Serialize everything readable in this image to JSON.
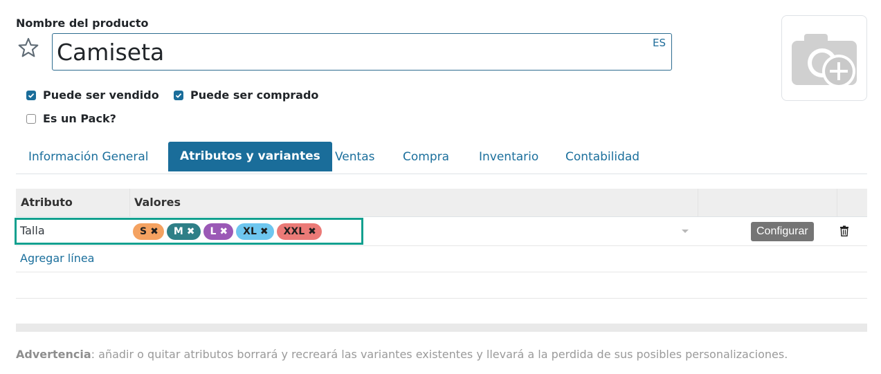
{
  "product": {
    "label": "Nombre del producto",
    "name": "Camiseta",
    "lang": "ES"
  },
  "checkboxes": [
    {
      "label": "Puede ser vendido",
      "checked": true
    },
    {
      "label": "Puede ser comprado",
      "checked": true
    },
    {
      "label": "Es un Pack?",
      "checked": false
    }
  ],
  "tabs": [
    {
      "label": "Información General",
      "active": false
    },
    {
      "label": "Atributos y variantes",
      "active": true
    },
    {
      "label": "Ventas",
      "active": false
    },
    {
      "label": "Compra",
      "active": false
    },
    {
      "label": "Inventario",
      "active": false
    },
    {
      "label": "Contabilidad",
      "active": false
    }
  ],
  "table": {
    "headers": {
      "attribute": "Atributo",
      "values": "Valores"
    },
    "rows": [
      {
        "attribute": "Talla",
        "values": [
          {
            "label": "S",
            "color": "#f4a261"
          },
          {
            "label": "M",
            "color": "#2f7f87"
          },
          {
            "label": "L",
            "color": "#9b59b6"
          },
          {
            "label": "XL",
            "color": "#6ec6ef"
          },
          {
            "label": "XXL",
            "color": "#eb7a77"
          }
        ],
        "configure_label": "Configurar"
      }
    ],
    "add_line": "Agregar línea"
  },
  "warning": {
    "strong": "Advertencia",
    "text": ": añadir o quitar atributos borrará y recreará las variantes existentes y llevará a la perdida de sus posibles personalizaciones."
  },
  "icons": {
    "favorite": "star-outline-icon",
    "photo": "camera-add-icon",
    "delete": "trash-icon",
    "dropdown": "caret-down-icon",
    "remove_tag": "x-icon"
  },
  "colors": {
    "accent": "#1a6d9a",
    "highlight": "#12a08f"
  }
}
